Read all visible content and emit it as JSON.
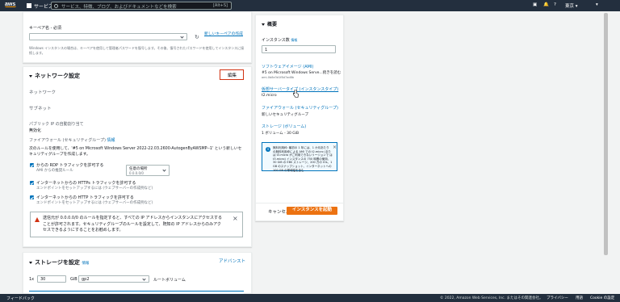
{
  "topnav": {
    "logo": "aws",
    "services": "サービス",
    "search_placeholder": "サービス、特徴、ブログ、およびドキュメントなどを検索",
    "search_shortcut": "[Alt+S]",
    "region": "東京 ▾",
    "account": "▾"
  },
  "keypair": {
    "label": "キーペア名 - 必須",
    "select_value": "",
    "create_link": "新しいキーペアの作成",
    "help": "Windows インスタンスの場合は、キーペアを使用して管理者パスワードを復号します。その後、復号されたパスワードを使用してインスタンスに接続します。"
  },
  "network": {
    "title": "ネットワーク設定",
    "edit_button": "編集",
    "network_label": "ネットワーク",
    "subnet_label": "サブネット",
    "public_ip_label": "パブリック IP の自動割り当て",
    "public_ip_value": "無効化",
    "firewall_label": "ファイアウォール (セキュリティグループ)",
    "firewall_info": "情報",
    "rule_text": "次のルールを使用して、'#5 on Microsoft Windows Server 2022-22.03.2600-AutogenByAWSMP--1' という新しいセキュリティグループを作成します。",
    "rdp_label": "からの RDP トラフィックを許可する",
    "rdp_sub": "AMI からの推奨ルール",
    "rdp_select": "任意の場所",
    "rdp_select_sub": "0.0.0.0/0",
    "https_label": "インターネットからの HTTPs トラフィックを許可する",
    "https_sub": "エンドポイントをセットアップするには (ウェブサーバーの作成例など)",
    "http_label": "インターネットからの HTTP トラフィックを許可する",
    "http_sub": "エンドポイントをセットアップするには (ウェブサーバーの作成例など)",
    "warning": "送信元が 0.0.0.0/0 のルールを指定すると、すべての IP アドレスからインスタンスにアクセスすることが許可されます。セキュリティグループのルールを設定して、既知の IP アドレスからのみアクセスできるようにすることをお勧めします。"
  },
  "storage": {
    "title": "ストレージを設定",
    "info": "情報",
    "advanced": "アドバンスト",
    "prefix": "1x",
    "size": "30",
    "unit": "GiB",
    "type": "gp2",
    "root_label": "ルートボリューム"
  },
  "summary": {
    "title": "概要",
    "instance_count_label": "インスタンス数",
    "instance_count_info": "情報",
    "instance_count_value": "1",
    "ami_label": "ソフトウェアイメージ (AMI)",
    "ami_value": "#5 on Microsoft Windows Serve...続きを読む",
    "ami_id": "ami-0b8e3d1f8d7ad8b",
    "type_label": "仮想サーバータイプ (インスタンスタイプ)",
    "type_value": "t2.micro",
    "firewall_label": "ファイアウォール (セキュリティグループ)",
    "firewall_value": "新しいセキュリティグループ",
    "storage_label": "ストレージ (ボリューム)",
    "storage_value": "1 ボリューム - 30 GiB",
    "free_tier": "無料利用枠: 最初の 1 年には、1 か月あたり の無料利用枠による AMI での t2.micro (または t3.micro がご利用できないリージョンで は t3.micro) インスタンスの 750 時間の使用、30 GiB の EBS ストレージ、200 万の IOs、1 GB のスナップショット、インターネットへの 100 GB の帯域幅を含む",
    "cancel": "キャンセル",
    "launch": "インスタンスを起動"
  },
  "footer": {
    "feedback": "フィードバック",
    "copyright": "© 2022, Amazon Web Services, Inc. またはその関連会社。",
    "privacy": "プライバシー",
    "terms": "用語",
    "cookie": "Cookie の設定"
  },
  "colors": {
    "nav": "#232f3e",
    "accent": "#ec7211",
    "link": "#0073bb",
    "warning": "#d13212"
  }
}
